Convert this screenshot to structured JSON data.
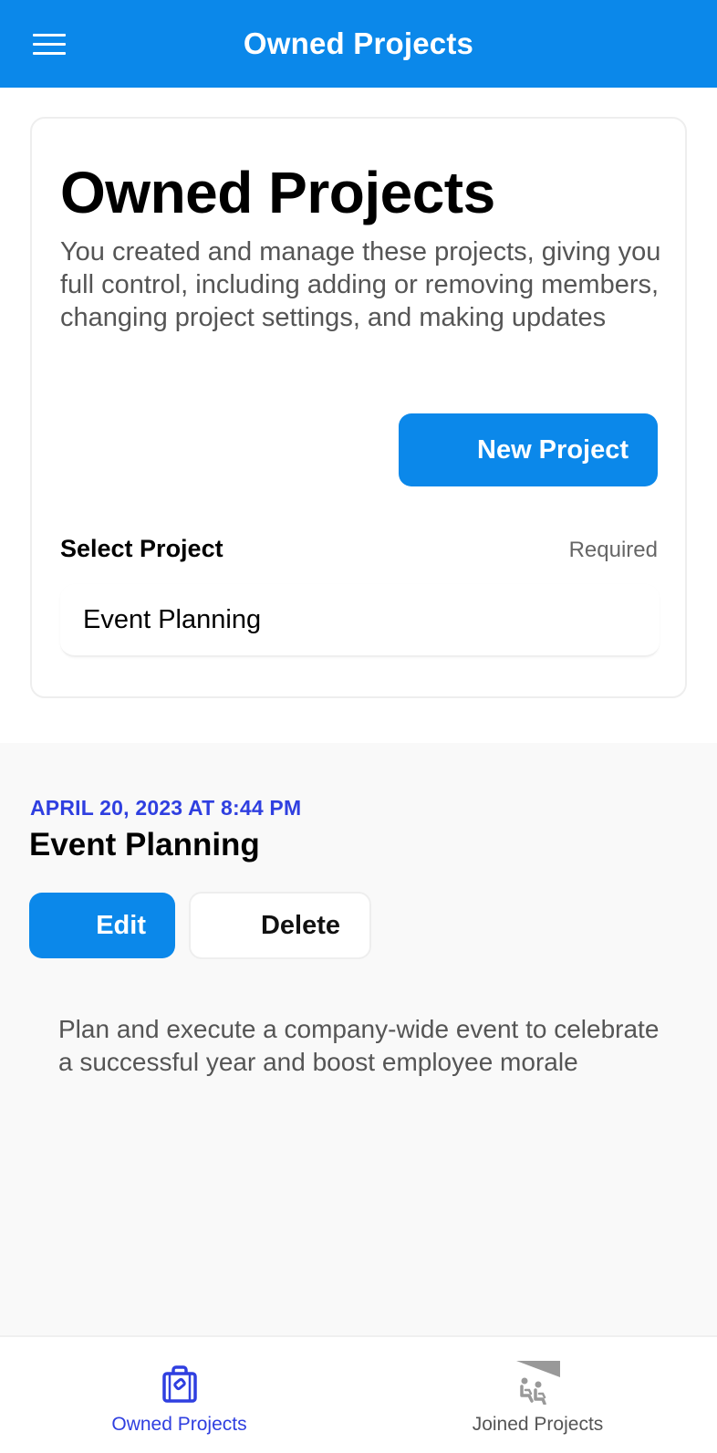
{
  "appbar": {
    "title": "Owned Projects",
    "menu_icon": "hamburger-menu-icon",
    "background_color": "#0b88ea"
  },
  "header_card": {
    "title": "Owned Projects",
    "description": "You created and manage these projects, giving you full control, including adding or removing members, changing project settings, and making updates",
    "new_project_label": "New Project",
    "select": {
      "label": "Select Project",
      "required_label": "Required",
      "value": "Event Planning"
    }
  },
  "project": {
    "date": "APRIL 20, 2023 AT 8:44 PM",
    "name": "Event Planning",
    "edit_label": "Edit",
    "delete_label": "Delete",
    "description": "Plan and execute a company-wide event to celebrate a successful year and boost employee morale"
  },
  "bottom_nav": {
    "items": [
      {
        "label": "Owned Projects",
        "icon": "briefcase-icon",
        "active": true,
        "color": "#2f3fe0"
      },
      {
        "label": "Joined Projects",
        "icon": "seated-people-icon",
        "active": false,
        "color": "#999999"
      }
    ]
  },
  "colors": {
    "primary": "#0b88ea",
    "accent": "#2f3fe0",
    "muted_text": "#555555"
  }
}
